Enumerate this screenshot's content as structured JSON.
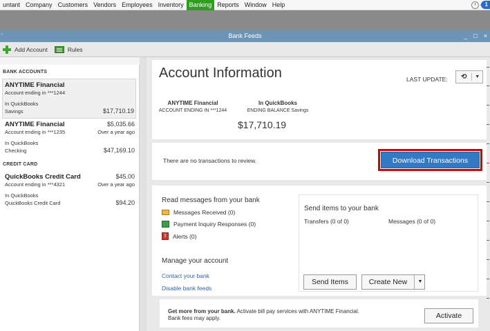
{
  "menu": {
    "items": [
      "untant",
      "Company",
      "Customers",
      "Vendors",
      "Employees",
      "Inventory",
      "Banking",
      "Reports",
      "Window",
      "Help"
    ],
    "active_index": 6,
    "notification_count": "1"
  },
  "window": {
    "title": "Bank Feeds",
    "left_tick": "'",
    "minimize": "_",
    "restore": "□",
    "close": "×"
  },
  "toolbar": {
    "add_account": "Add Account",
    "rules": "Rules"
  },
  "sidebar": {
    "bank_heading": "BANK ACCOUNTS",
    "bank_accounts": [
      {
        "name": "ANYTIME Financial",
        "name_value": "",
        "ending": "Account ending in ***1244",
        "ending_value": "",
        "qb_label": "In QuickBooks",
        "qb_type": "Savings",
        "qb_value": "$17,710.19",
        "selected": true
      },
      {
        "name": "ANYTIME Financial",
        "name_value": "$5,035.66",
        "ending": "Account ending in ***1235",
        "ending_value": "Over a year ago",
        "qb_label": "In QuickBooks",
        "qb_type": "Checking",
        "qb_value": "$47,169.10",
        "selected": false
      }
    ],
    "credit_heading": "CREDIT CARD",
    "credit_accounts": [
      {
        "name": "QuickBooks Credit Card",
        "name_value": "$45.00",
        "ending": "Account ending in ***4321",
        "ending_value": "Over a year ago",
        "qb_label": "In QuickBooks",
        "qb_type": "QuickBooks Credit Card",
        "qb_value": "$94.20",
        "selected": false
      }
    ]
  },
  "main": {
    "title": "Account Information",
    "last_update_label": "LAST UPDATE:",
    "refresh_glyph": "⟲",
    "caret": "▼",
    "bank_name": "ANYTIME Financial",
    "bank_sub": "ACCOUNT ENDING IN ***1244",
    "qb_name": "In QuickBooks",
    "qb_sub": "ENDING BALANCE Savings",
    "balance": "$17,710.19",
    "no_transactions": "There are no transactions to review.",
    "download_button": "Download Transactions",
    "read_messages_title": "Read messages from your bank",
    "messages_received": "Messages Received (0)",
    "payment_inquiry": "Payment Inquiry Responses (0)",
    "alerts": "Alerts (0)",
    "alert_glyph": "!",
    "manage_title": "Manage your account",
    "contact_link": "Contact your bank",
    "disable_link": "Disable bank feeds",
    "send_title": "Send items to your bank",
    "transfers": "Transfers (0 of 0)",
    "messages": "Messages (0 of 0)",
    "send_items_button": "Send Items",
    "create_new_button": "Create New",
    "promo_bold": "Get more from your bank.",
    "promo_text": "Activate bill pay services with ANYTIME Financial.",
    "promo_line2": "Bank fees may apply.",
    "activate_button": "Activate"
  },
  "colors": {
    "banking_menu": "#2ca01c",
    "title_bar": "#6d95b8",
    "download_button": "#3479c4",
    "highlight_outline": "#d40000"
  }
}
